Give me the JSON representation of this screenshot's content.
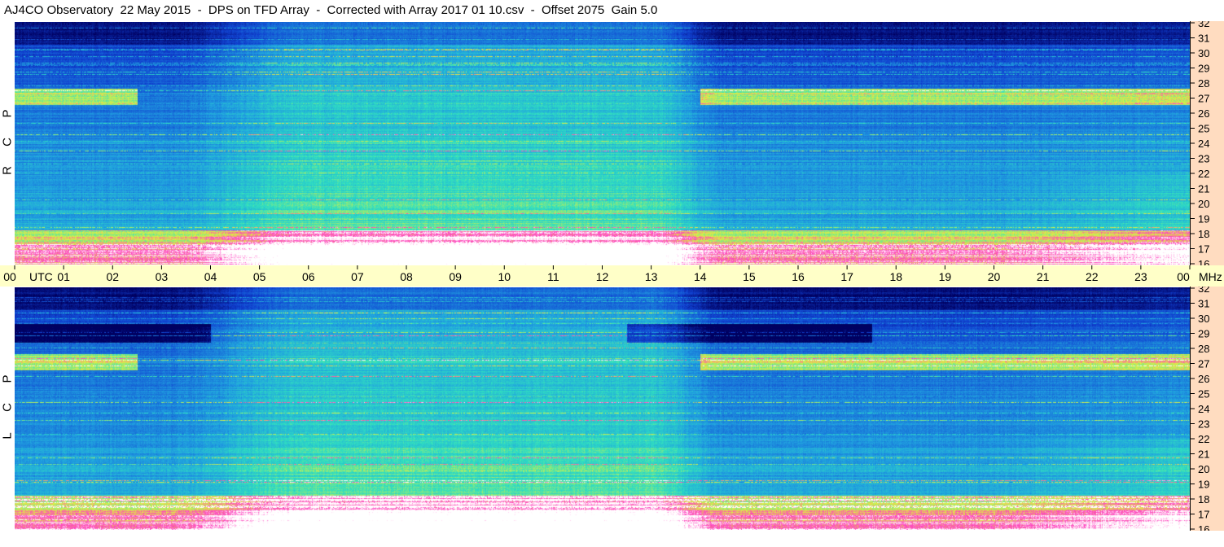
{
  "title": "AJ4CO Observatory  22 May 2015  -  DPS on TFD Array  -  Corrected with Array 2017 01 10.csv  -  Offset 2075  Gain 5.0",
  "chart_data": {
    "type": "heatmap",
    "title": "AJ4CO Observatory  22 May 2015  -  DPS on TFD Array  -  Corrected with Array 2017 01 10.csv  -  Offset 2075  Gain 5.0",
    "x_axis": {
      "ticks": [
        "00",
        "01",
        "02",
        "03",
        "04",
        "05",
        "06",
        "07",
        "08",
        "09",
        "10",
        "11",
        "12",
        "13",
        "14",
        "15",
        "16",
        "17",
        "18",
        "19",
        "20",
        "21",
        "22",
        "23",
        "00"
      ],
      "utc_label": "UTC",
      "unit_label": "MHz",
      "range_hours": [
        0,
        24
      ]
    },
    "y_axis": {
      "ticks": [
        32,
        31,
        30,
        29,
        28,
        27,
        26,
        25,
        24,
        23,
        22,
        21,
        20,
        19,
        18,
        17,
        16
      ],
      "range_mhz": [
        16,
        32
      ]
    },
    "panels": [
      {
        "polarization": [
          "R",
          "C",
          "P"
        ]
      },
      {
        "polarization": [
          "L",
          "C",
          "P"
        ]
      }
    ],
    "colors": {
      "low": "#000060",
      "mid_low": "#1040d0",
      "mid": "#20a0e0",
      "mid_high": "#30e0c0",
      "high": "#e0f040",
      "very_high": "#ff40c0",
      "saturated": "#ffffff"
    }
  }
}
